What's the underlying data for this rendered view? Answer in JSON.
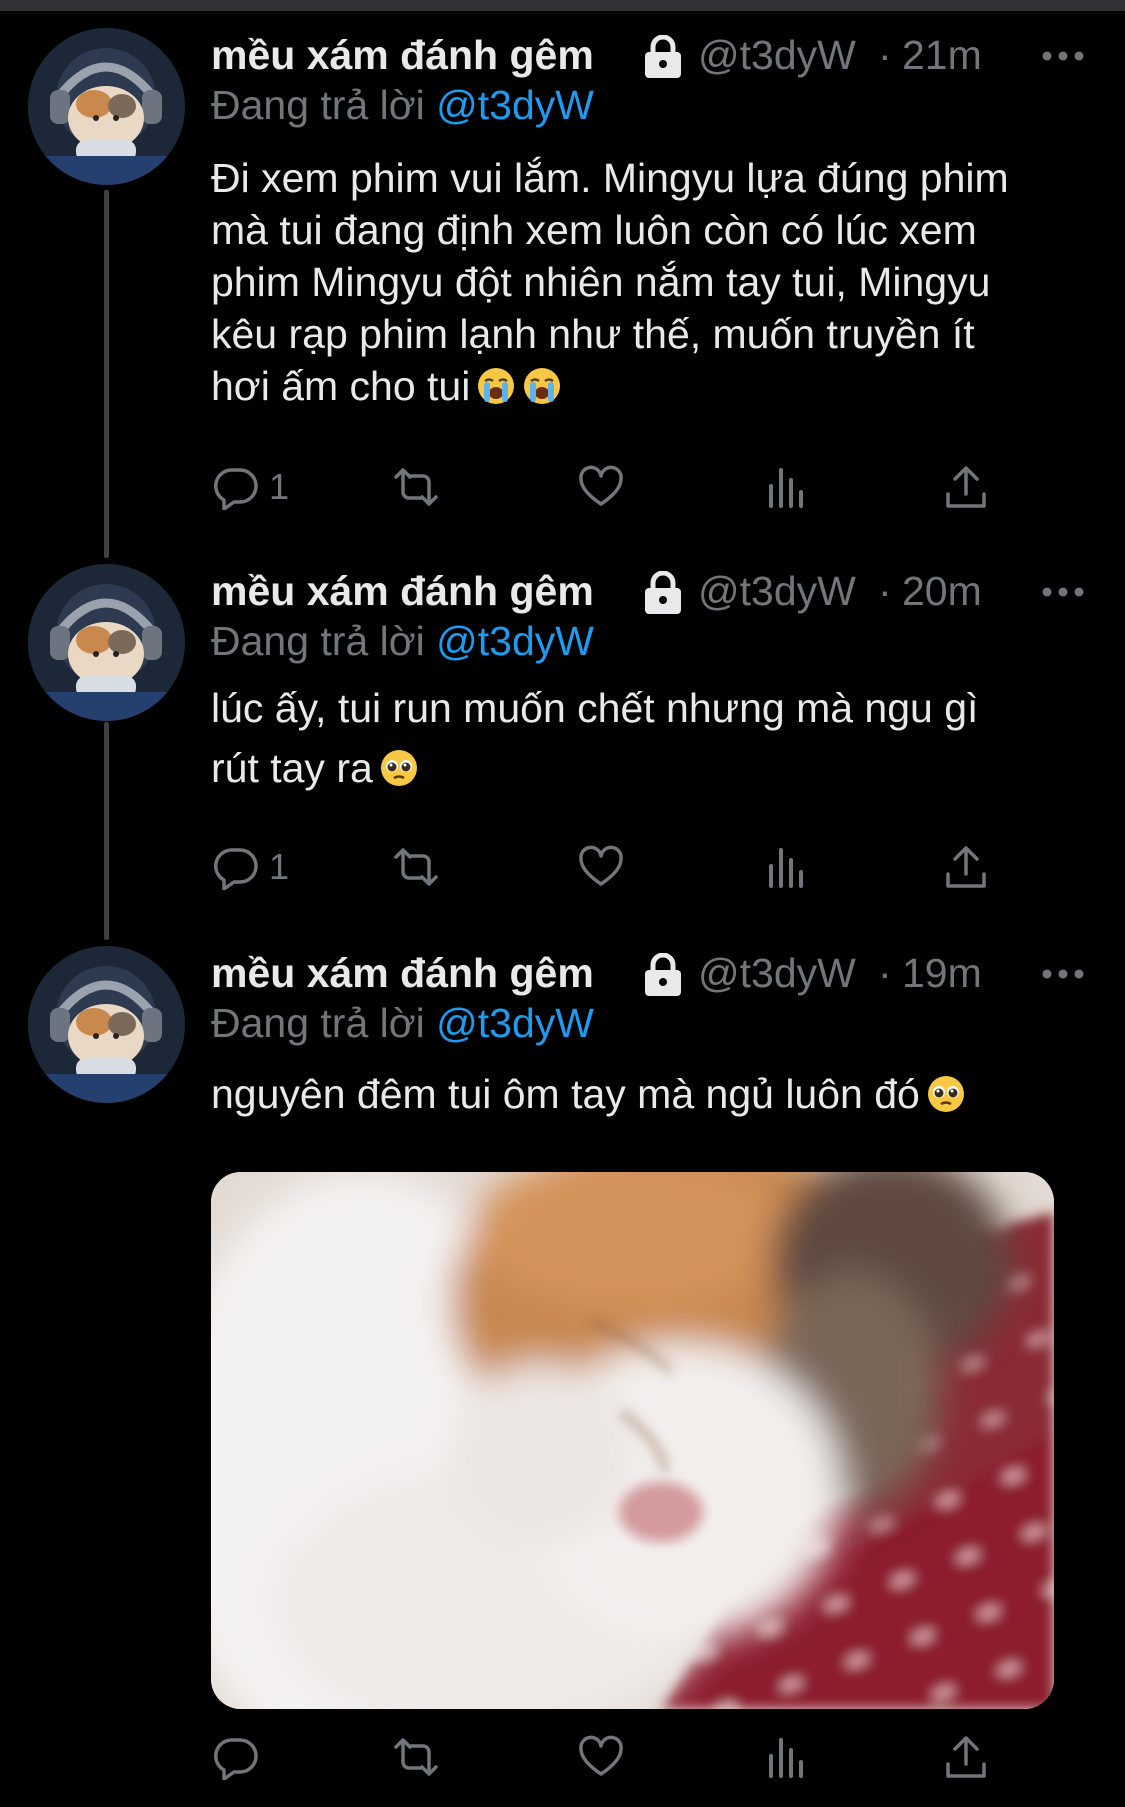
{
  "colors": {
    "background": "#000000",
    "text_primary": "#e7e9ea",
    "text_secondary": "#71767b",
    "accent_link": "#1d9bf0",
    "thread_line": "#3e4144"
  },
  "tweets": [
    {
      "display_name": "mều xám đánh gêm",
      "handle": "@t3dyW",
      "separator": "·",
      "time": "21m",
      "reply_prefix": "Đang trả lời ",
      "reply_to": "@t3dyW",
      "text": "Đi xem phim vui lắm. Mingyu lựa đúng phim\nmà tui đang định xem luôn còn có lúc xem\nphim Mingyu đột nhiên nắm tay tui, Mingyu\nkêu rạp phim lạnh như thế, muốn truyền ít\nhơi ấm cho tui",
      "emojis": [
        "loudly-crying-face-emoji",
        "loudly-crying-face-emoji"
      ],
      "reply_count": "1",
      "icons": [
        "lock-icon",
        "more-icon",
        "reply-icon",
        "retweet-icon",
        "like-icon",
        "views-icon",
        "share-icon"
      ]
    },
    {
      "display_name": "mều xám đánh gêm",
      "handle": "@t3dyW",
      "separator": "·",
      "time": "20m",
      "reply_prefix": "Đang trả lời ",
      "reply_to": "@t3dyW",
      "text": "lúc ấy, tui run muốn chết nhưng mà ngu gì\nrút tay ra",
      "emojis": [
        "pleading-face-emoji"
      ],
      "reply_count": "1"
    },
    {
      "display_name": "mều xám đánh gêm",
      "handle": "@t3dyW",
      "separator": "·",
      "time": "19m",
      "reply_prefix": "Đang trả lời ",
      "reply_to": "@t3dyW",
      "text": "nguyên đêm tui ôm tay mà ngủ luôn đó",
      "emojis": [
        "pleading-face-emoji"
      ],
      "reply_count": "",
      "media": "sleeping-cat-photo"
    }
  ]
}
